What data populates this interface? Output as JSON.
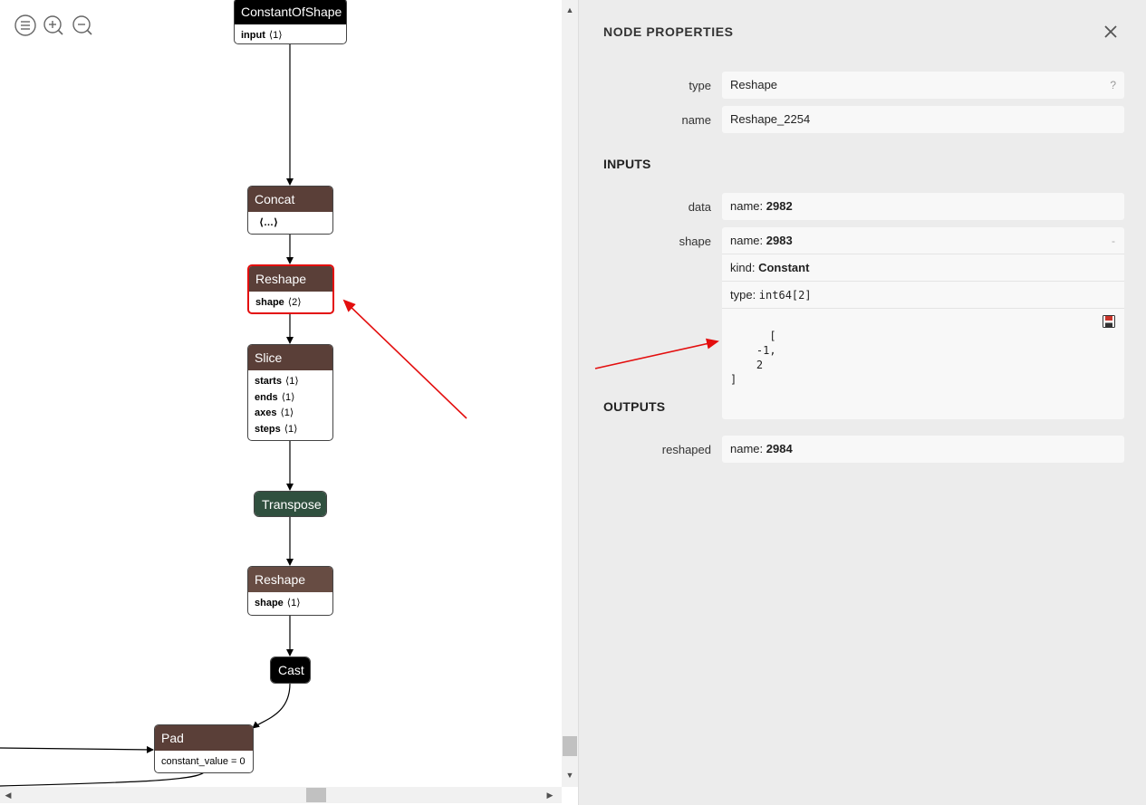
{
  "graph": {
    "toolbar": {
      "menu": "menu-icon",
      "zoom_in": "zoom-in-icon",
      "zoom_out": "zoom-out-icon"
    },
    "nodes": {
      "constant_of_shape": {
        "title": "ConstantOfShape",
        "color": "#000000",
        "attrs": [
          {
            "name": "input",
            "value": "⟨1⟩"
          }
        ]
      },
      "concat": {
        "title": "Concat",
        "color": "#5a3f38",
        "attrs": [
          {
            "name": "",
            "value": "⟨…⟩"
          }
        ]
      },
      "reshape_selected": {
        "title": "Reshape",
        "color": "#5a3f38",
        "attrs": [
          {
            "name": "shape",
            "value": "⟨2⟩"
          }
        ]
      },
      "slice": {
        "title": "Slice",
        "color": "#5a3f38",
        "attrs": [
          {
            "name": "starts",
            "value": "⟨1⟩"
          },
          {
            "name": "ends",
            "value": "⟨1⟩"
          },
          {
            "name": "axes",
            "value": "⟨1⟩"
          },
          {
            "name": "steps",
            "value": "⟨1⟩"
          }
        ]
      },
      "transpose": {
        "title": "Transpose",
        "color": "#30503f"
      },
      "reshape2": {
        "title": "Reshape",
        "color": "#674c43",
        "attrs": [
          {
            "name": "shape",
            "value": "⟨1⟩"
          }
        ]
      },
      "cast": {
        "title": "Cast",
        "color": "#000000"
      },
      "pad": {
        "title": "Pad",
        "color": "#5a3f38",
        "attrs": [
          {
            "name": "",
            "value": "constant_value = 0"
          }
        ]
      }
    },
    "annotation_color": "#e30e0e"
  },
  "sidebar": {
    "title": "NODE PROPERTIES",
    "close_icon": "close-icon",
    "node": {
      "type_label": "type",
      "type_value": "Reshape",
      "help": "?",
      "name_label": "name",
      "name_value": "Reshape_2254"
    },
    "inputs_title": "INPUTS",
    "inputs": {
      "data": {
        "label": "data",
        "name_prefix": "name: ",
        "name": "2982"
      },
      "shape": {
        "label": "shape",
        "name_prefix": "name: ",
        "name": "2983",
        "collapse": "-",
        "kind_prefix": "kind: ",
        "kind": "Constant",
        "type_prefix": "type: ",
        "type": "int64[2]",
        "tensor": "[\n    -1,\n    2\n]",
        "save_icon": "save-icon"
      }
    },
    "outputs_title": "OUTPUTS",
    "outputs": {
      "reshaped": {
        "label": "reshaped",
        "name_prefix": "name: ",
        "name": "2984"
      }
    }
  }
}
